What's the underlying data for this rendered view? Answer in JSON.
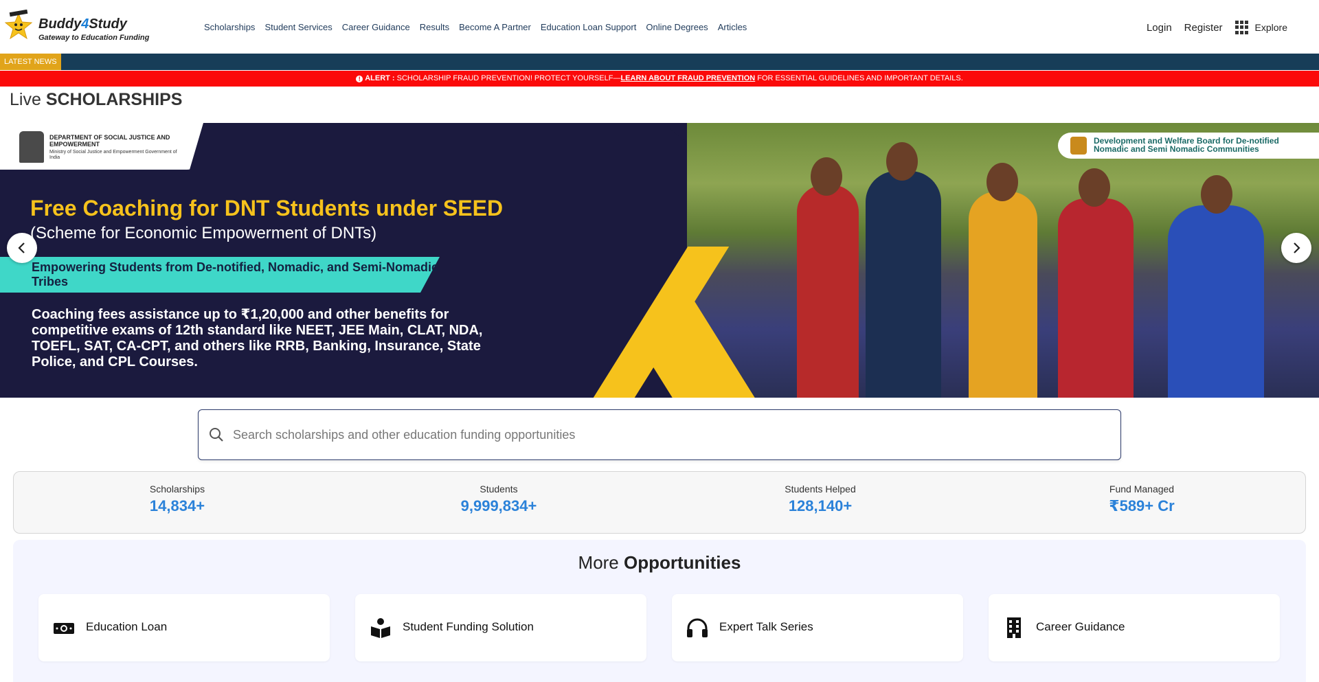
{
  "header": {
    "logo_brand_a": "Buddy",
    "logo_brand_b": "4",
    "logo_brand_c": "Study",
    "logo_tagline": "Gateway to Education Funding",
    "nav": [
      {
        "label": "Scholarships"
      },
      {
        "label": "Student Services"
      },
      {
        "label": "Career Guidance"
      },
      {
        "label": "Results"
      },
      {
        "label": "Become A Partner"
      },
      {
        "label": "Education Loan Support"
      },
      {
        "label": "Online Degrees"
      },
      {
        "label": "Articles"
      }
    ],
    "login": "Login",
    "register": "Register",
    "explore": "Explore"
  },
  "newsbar": {
    "tag": "LATEST NEWS"
  },
  "alert": {
    "prefix": "ALERT :",
    "text": "SCHOLARSHIP FRAUD PREVENTION! PROTECT YOURSELF—",
    "link": "Learn About Fraud Prevention",
    "suffix": "FOR ESSENTIAL GUIDELINES AND IMPORTANT DETAILS."
  },
  "live": {
    "prefix": "Live",
    "title": "SCHOLARSHIPS"
  },
  "banner": {
    "dept_name": "DEPARTMENT OF SOCIAL JUSTICE AND EMPOWERMENT",
    "dept_sub": "Ministry of Social Justice and Empowerment Government of India",
    "board": "Development and Welfare Board for De-notified Nomadic and Semi Nomadic Communities",
    "title": "Free Coaching for DNT Students under SEED",
    "subtitle": "(Scheme for Economic Empowerment of DNTs)",
    "highlight": "Empowering Students from De-notified, Nomadic, and Semi-Nomadic Tribes",
    "body": "Coaching fees assistance up to ₹1,20,000 and other benefits for competitive exams of 12th standard like NEET, JEE Main, CLAT, NDA, TOEFL, SAT, CA-CPT, and others like RRB, Banking, Insurance, State Police, and CPL Courses."
  },
  "search": {
    "placeholder": "Search scholarships and other education funding opportunities"
  },
  "stats": [
    {
      "label": "Scholarships",
      "value": "14,834+"
    },
    {
      "label": "Students",
      "value": "9,999,834+"
    },
    {
      "label": "Students Helped",
      "value": "128,140+"
    },
    {
      "label": "Fund Managed",
      "value": "₹589+ Cr"
    }
  ],
  "opportunities": {
    "title_prefix": "More",
    "title_bold": "Opportunities",
    "items": [
      {
        "label": "Education Loan",
        "icon": "money-icon"
      },
      {
        "label": "Student Funding Solution",
        "icon": "reader-icon"
      },
      {
        "label": "Expert Talk Series",
        "icon": "headphones-icon"
      },
      {
        "label": "Career Guidance",
        "icon": "building-icon"
      }
    ]
  },
  "colors": {
    "accent_blue": "#2b82d9",
    "news_bar": "#173d58",
    "news_tag": "#e1a41a",
    "alert_red": "#fb0a0a",
    "banner_navy": "#1b1a3e",
    "banner_yellow": "#f6c21c",
    "banner_teal": "#3fd7c8"
  }
}
